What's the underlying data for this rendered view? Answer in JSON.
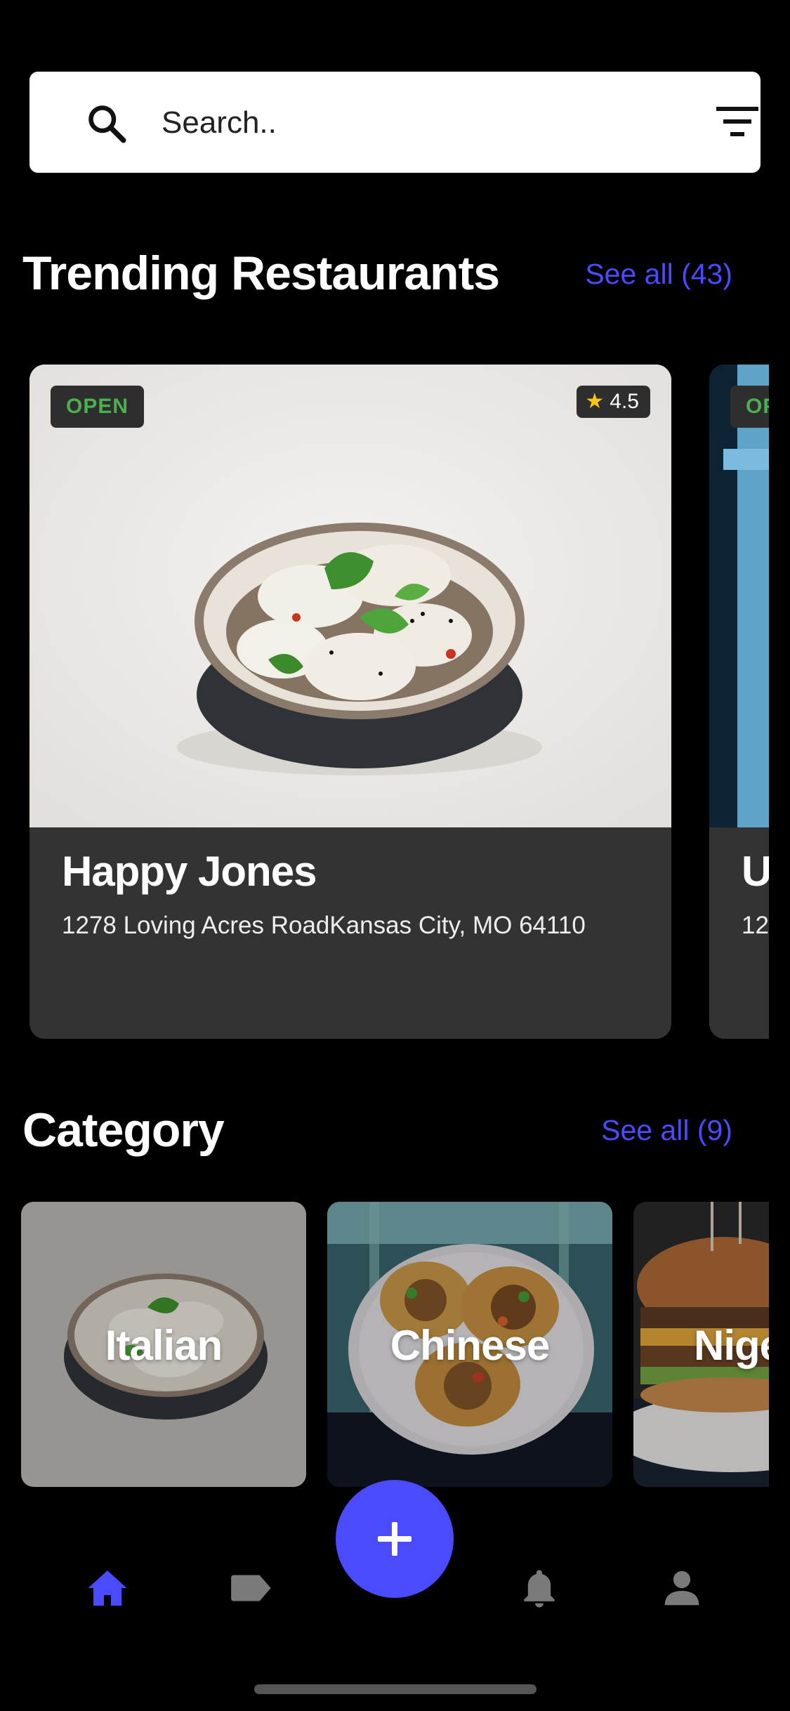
{
  "search": {
    "placeholder": "Search..",
    "value": "",
    "search_icon": "search-icon",
    "filter_icon": "filter-icon"
  },
  "trending": {
    "title": "Trending Restaurants",
    "see_all": "See all (43)",
    "cards": [
      {
        "status": "OPEN",
        "rating": "4.5",
        "name": "Happy Jones",
        "address": "1278 Loving Acres RoadKansas City, MO 64110"
      },
      {
        "status": "OP",
        "name": "U",
        "address": "12"
      }
    ]
  },
  "category": {
    "title": "Category",
    "see_all": "See all (9)",
    "items": [
      {
        "label": "Italian"
      },
      {
        "label": "Chinese"
      },
      {
        "label": "Nige"
      }
    ]
  },
  "fab": {
    "icon": "plus-icon"
  },
  "bottom_nav": {
    "items": [
      {
        "icon": "home-icon",
        "active": true
      },
      {
        "icon": "tag-icon",
        "active": false
      },
      {
        "icon": "bell-icon",
        "active": false
      },
      {
        "icon": "profile-icon",
        "active": false
      }
    ]
  },
  "colors": {
    "accent": "#4A4BFF",
    "background": "#000000",
    "card": "#333333",
    "open_green": "#4CAF50",
    "star": "#F5C518",
    "inactive_icon": "#7A7A7A"
  }
}
